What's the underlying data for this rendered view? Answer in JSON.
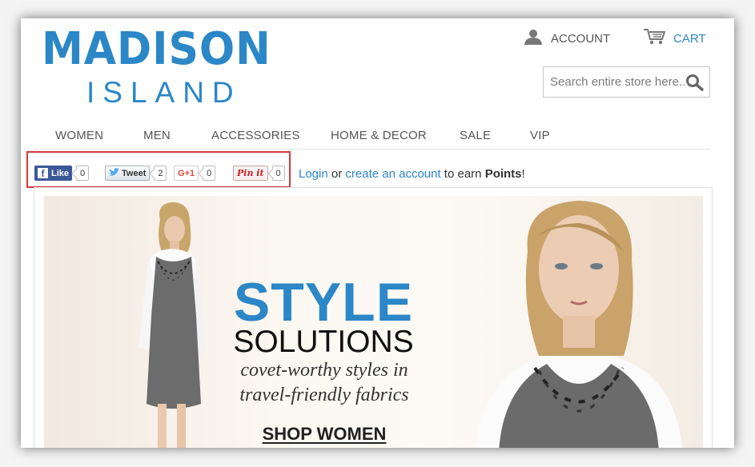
{
  "logo": {
    "line1": "MADISON",
    "line2": "ISLAND"
  },
  "header": {
    "account_label": "ACCOUNT",
    "cart_label": "CART",
    "search_placeholder": "Search entire store here..."
  },
  "nav": {
    "items": [
      {
        "label": "WOMEN"
      },
      {
        "label": "MEN"
      },
      {
        "label": "ACCESSORIES"
      },
      {
        "label": "HOME & DECOR"
      },
      {
        "label": "SALE"
      },
      {
        "label": "VIP"
      }
    ]
  },
  "social": {
    "like": {
      "label": "Like",
      "count": "0"
    },
    "tweet": {
      "label": "Tweet",
      "count": "2"
    },
    "gplus": {
      "label": "G+1",
      "count": "0"
    },
    "pin": {
      "label": "Pin it",
      "count": "0"
    }
  },
  "points": {
    "login_link": "Login",
    "or": " or ",
    "create_link": "create an account",
    "earn": " to earn ",
    "points_word": "Points",
    "end": "!"
  },
  "banner": {
    "title": "STYLE",
    "subtitle": "SOLUTIONS",
    "tagline1": "covet-worthy styles in",
    "tagline2": "travel-friendly fabrics",
    "cta": "SHOP WOMEN"
  },
  "colors": {
    "brand": "#2b87c7",
    "highlight_box": "#d43a3a",
    "facebook": "#3b5998"
  }
}
